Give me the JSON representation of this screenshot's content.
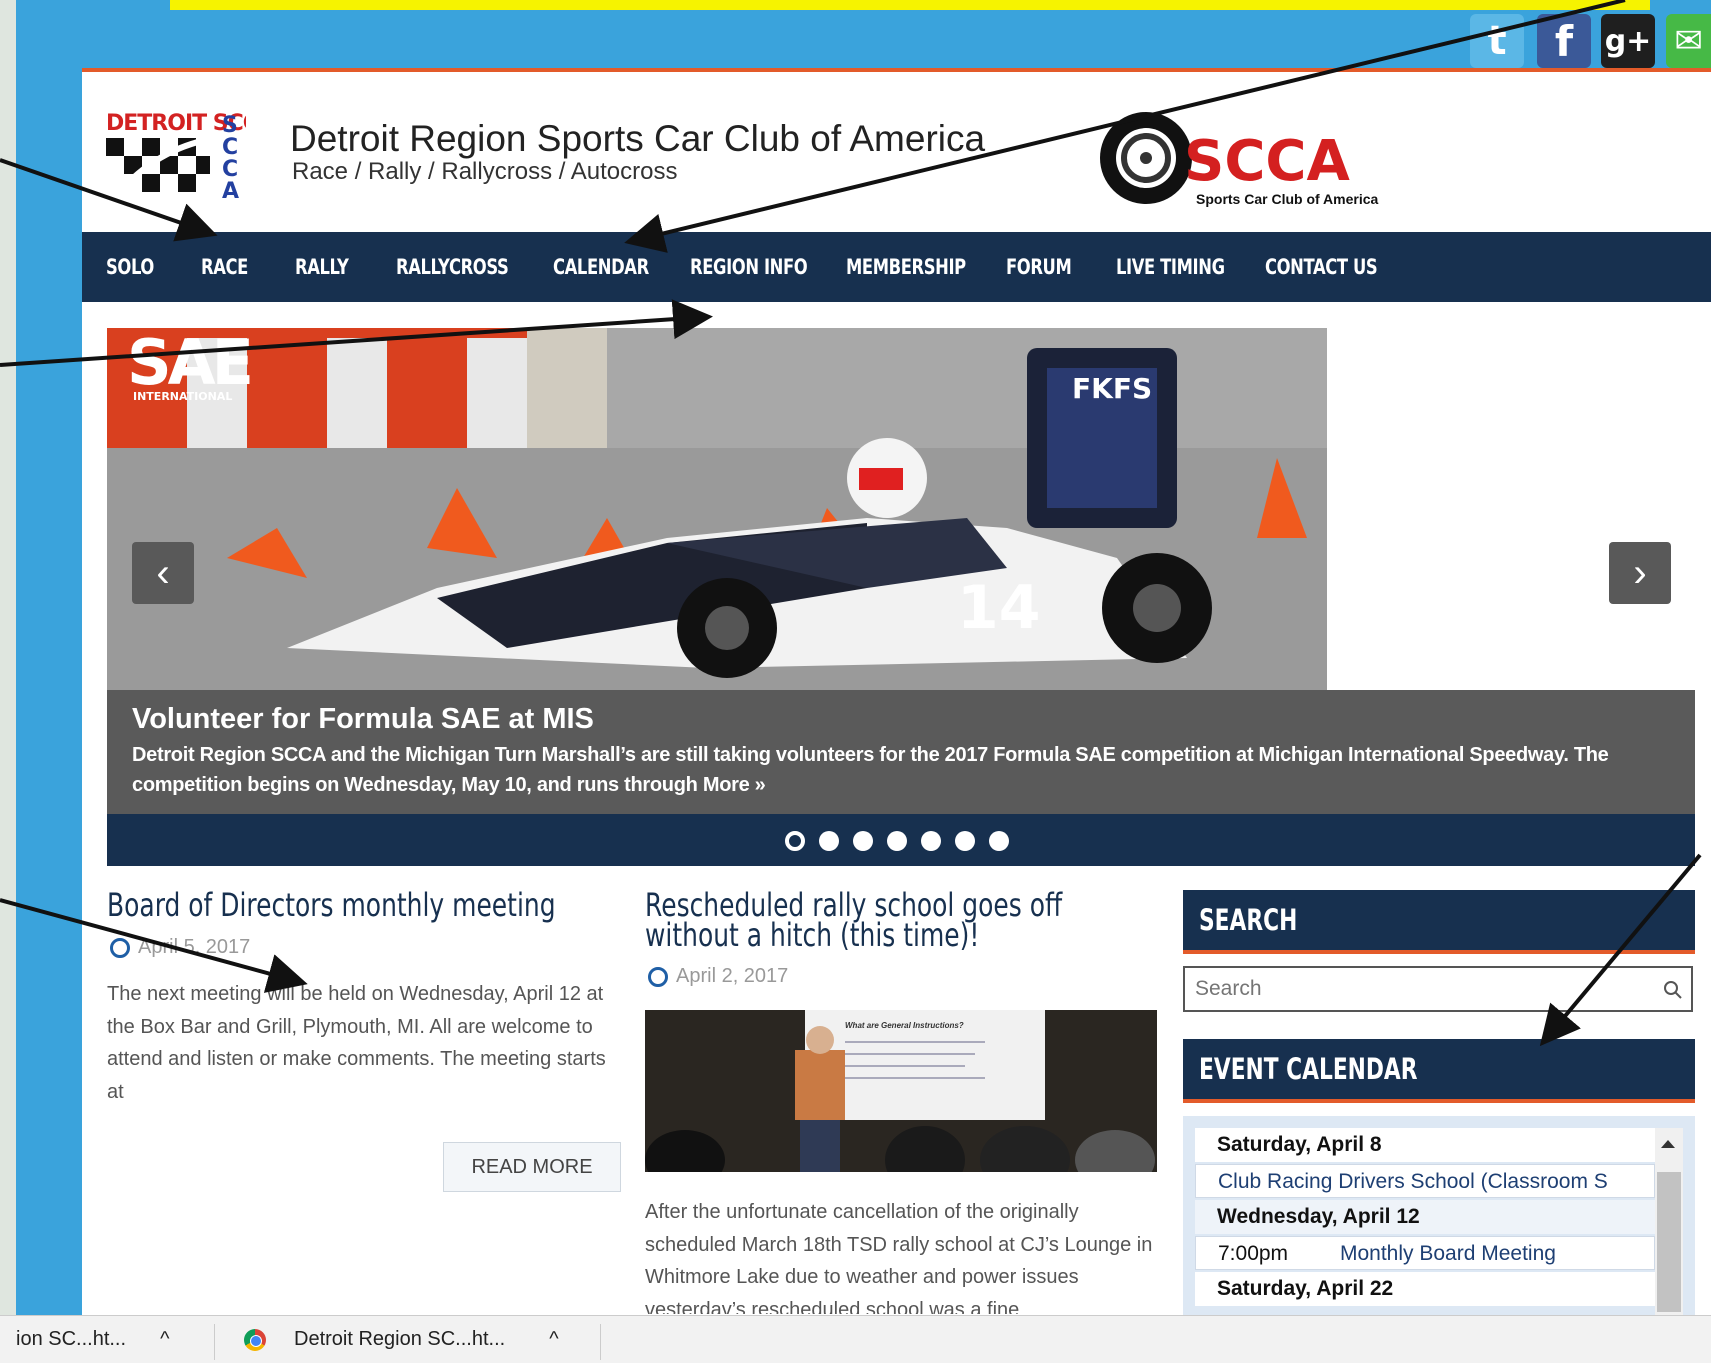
{
  "header": {
    "title": "Detroit Region Sports Car Club of America",
    "subtitle": "Race / Rally / Rallycross / Autocross",
    "logo_text": "DETROIT SCCA",
    "scca_logo_text": "SCCA",
    "scca_logo_sub": "Sports Car Club of America"
  },
  "social": {
    "twitter_glyph": "t",
    "facebook_glyph": "f",
    "google_glyph": "g+",
    "email_glyph": "✉"
  },
  "nav": {
    "items": [
      "SOLO",
      "RACE",
      "RALLY",
      "RALLYCROSS",
      "CALENDAR",
      "REGION INFO",
      "MEMBERSHIP",
      "FORUM",
      "LIVE TIMING",
      "CONTACT US"
    ]
  },
  "slider": {
    "title": "Volunteer for Formula SAE at MIS",
    "text": "Detroit Region SCCA and the Michigan Turn Marshall’s are still taking volunteers for the 2017 Formula SAE competition at Michigan International Speedway. The competition begins on Wednesday, May 10, and runs through",
    "more_label": "More »",
    "prev_glyph": "‹",
    "next_glyph": "›",
    "dot_count": 7,
    "active_dot": 1,
    "car_number": "14",
    "car_sponsor": "FKFS",
    "sae_logo": "SAE",
    "sae_sub": "INTERNATIONAL"
  },
  "posts": [
    {
      "title": "Board of Directors monthly meeting",
      "date": "April 5, 2017",
      "body": "The next meeting will be held on Wednesday, April 12 at the Box Bar and Grill, Plymouth, MI. All are welcome to attend and listen or make comments. The meeting starts at",
      "read_more": "READ MORE"
    },
    {
      "title": "Rescheduled rally school goes off without a hitch (this time)!",
      "date": "April 2, 2017",
      "body": "After the unfortunate cancellation of the originally scheduled March 18th TSD rally school at CJ’s Lounge in Whitmore Lake due to weather and power issues vesterdav’s rescheduled school was a fine",
      "image_slide_text": "What are General Instructions?"
    }
  ],
  "sidebar": {
    "search_heading": "SEARCH",
    "search_placeholder": "Search",
    "calendar_heading": "EVENT CALENDAR",
    "calendar_rows": [
      {
        "type": "date",
        "text": "Saturday, April 8"
      },
      {
        "type": "event",
        "time": "",
        "text": "Club Racing Drivers School (Classroom S"
      },
      {
        "type": "date",
        "text": "Wednesday, April 12"
      },
      {
        "type": "event",
        "time": "7:00pm",
        "text": "Monthly Board Meeting"
      },
      {
        "type": "date",
        "text": "Saturday, April 22"
      }
    ]
  },
  "taskbar": {
    "items": [
      {
        "label": "ion SC...ht...",
        "chevron": "^"
      },
      {
        "label": "Detroit Region SC...ht...",
        "chevron": "^"
      }
    ]
  }
}
